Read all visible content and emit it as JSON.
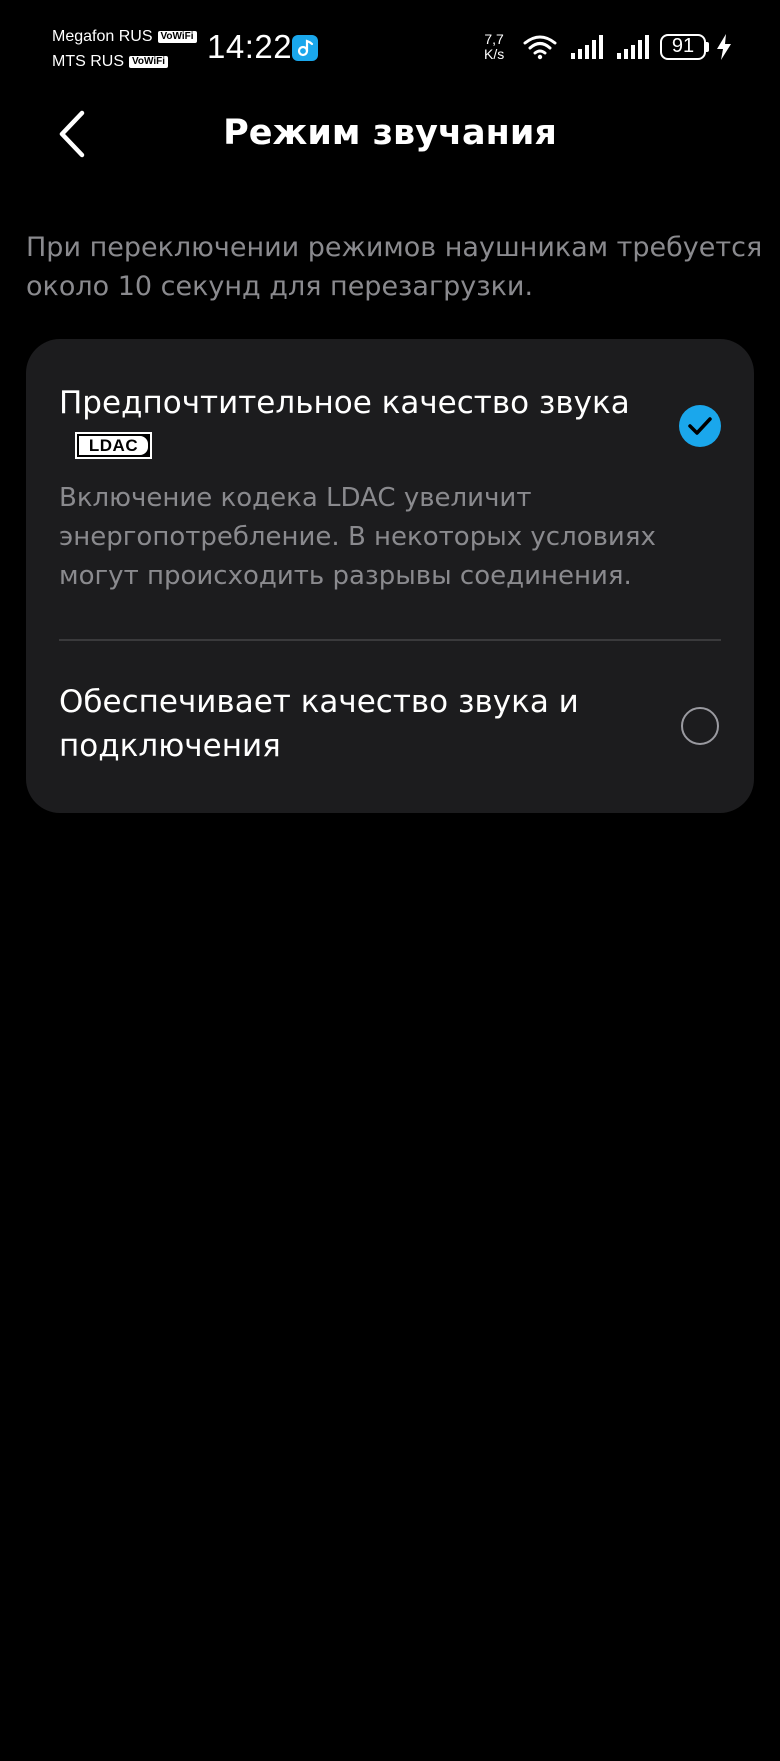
{
  "status_bar": {
    "carrier_1": "Megafon RUS",
    "carrier_2": "MTS RUS",
    "vowifi_badge": "VoWiFi",
    "time": "14:22",
    "net_speed_value": "7,7",
    "net_speed_unit": "K/s",
    "battery_level": "91",
    "icons": [
      "music-app-icon",
      "wifi-icon",
      "signal-icon",
      "signal-icon",
      "battery-icon",
      "charging-bolt-icon"
    ]
  },
  "header": {
    "title": "Режим звучания",
    "back_icon": "chevron-left-icon"
  },
  "description": "При переключении режимов наушникам требуется около 10 секунд для перезагрузки.",
  "options": [
    {
      "title": "Предпочтительное качество звука",
      "badge": "LDAC",
      "subtitle": "Включение кодека LDAC увеличит энергопотребление. В некоторых условиях могут происходить разрывы соединения.",
      "selected": true
    },
    {
      "title": "Обеспечивает качество звука и подключения",
      "selected": false
    }
  ],
  "colors": {
    "background": "#000000",
    "card": "#1c1c1e",
    "accent": "#1aa7ec",
    "secondary_text": "#8a8a8e",
    "divider": "#3a3a3c"
  }
}
